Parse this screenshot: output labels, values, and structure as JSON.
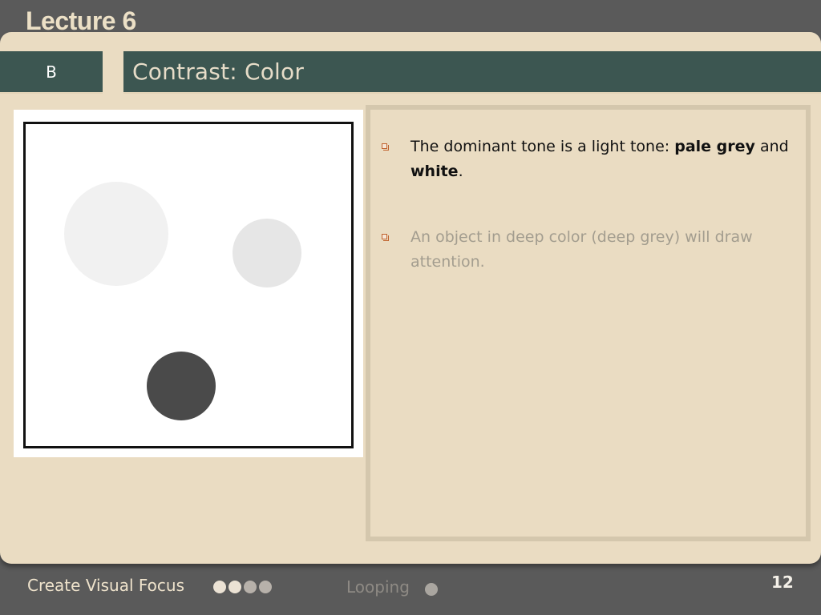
{
  "header": {
    "lecture_title": "Lecture 6"
  },
  "section": {
    "label": "B"
  },
  "slide": {
    "title": "Contrast: Color"
  },
  "figure": {
    "circles": [
      {
        "name": "large-pale-grey-circle",
        "color": "#f1f1f1"
      },
      {
        "name": "medium-light-grey-circle",
        "color": "#e6e6e6"
      },
      {
        "name": "deep-grey-circle",
        "color": "#4a4a4a"
      }
    ]
  },
  "bullets": [
    {
      "text_before": "The dominant tone is a light tone:   ",
      "bold1": "pale grey",
      "text_middle": " and ",
      "bold2": "white",
      "text_after": "."
    },
    {
      "text": "An object in deep color (deep grey) will draw attention."
    }
  ],
  "footer": {
    "section_name": "Create Visual Focus",
    "progress_dots": {
      "total": 4,
      "active": 2
    },
    "next_section": "Looping",
    "page_number": "12"
  },
  "colors": {
    "background": "#5a5a5a",
    "panel": "#eadcc2",
    "bar": "#3c5651",
    "bullet_icon": "#c0622d"
  }
}
